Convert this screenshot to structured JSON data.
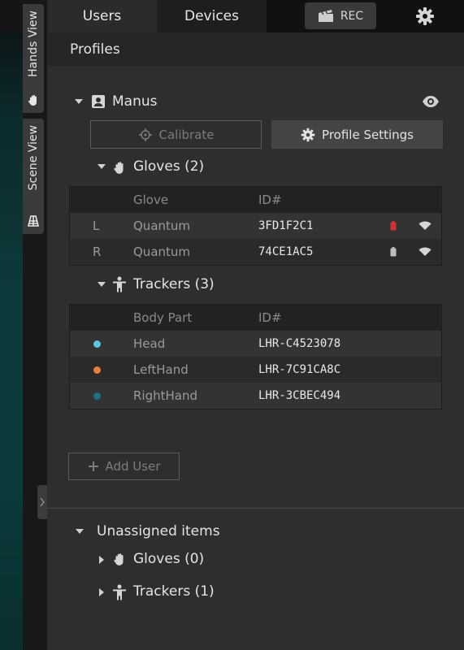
{
  "side_tabs": {
    "hands_view": "Hands View",
    "scene_view": "Scene View"
  },
  "top_tabs": {
    "users": "Users",
    "devices": "Devices"
  },
  "rec_label": "REC",
  "profiles_title": "Profiles",
  "user": {
    "name": "Manus",
    "calibrate_label": "Calibrate",
    "profile_settings_label": "Profile Settings",
    "gloves_title": "Gloves (2)",
    "gloves_headers": {
      "glove": "Glove",
      "id": "ID#"
    },
    "gloves": [
      {
        "side": "L",
        "type": "Quantum",
        "id": "3FD1F2C1",
        "battery_color": "#d03030"
      },
      {
        "side": "R",
        "type": "Quantum",
        "id": "74CE1AC5",
        "battery_color": "#bdbdbd"
      }
    ],
    "trackers_title": "Trackers (3)",
    "trackers_headers": {
      "body_part": "Body Part",
      "id": "ID#"
    },
    "trackers": [
      {
        "part": "Head",
        "id": "LHR-C4523078",
        "color": "#5cc6e0"
      },
      {
        "part": "LeftHand",
        "id": "LHR-7C91CA8C",
        "color": "#e8823a"
      },
      {
        "part": "RightHand",
        "id": "LHR-3CBEC494",
        "color": "#1b6f86"
      }
    ]
  },
  "add_user_label": "Add User",
  "unassigned": {
    "title": "Unassigned items",
    "gloves": "Gloves (0)",
    "trackers": "Trackers (1)"
  }
}
